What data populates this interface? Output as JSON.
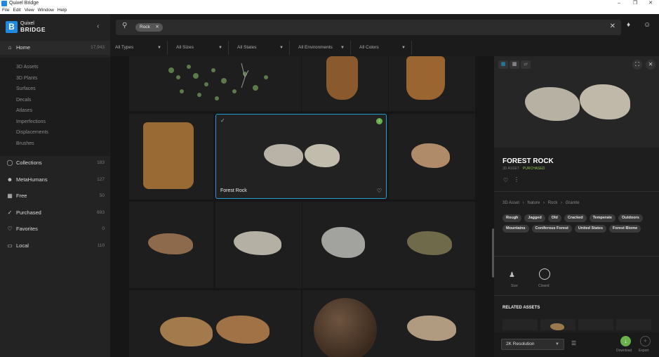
{
  "app": {
    "title": "Quixel Bridge",
    "menu": [
      "File",
      "Edit",
      "View",
      "Window",
      "Help"
    ]
  },
  "logo": {
    "line1": "Quixel",
    "line2": "BRIDGE"
  },
  "sidebar": {
    "home": {
      "label": "Home",
      "count": "17,943"
    },
    "sub_items": [
      "3D Assets",
      "3D Plants",
      "Surfaces",
      "Decals",
      "Atlases",
      "Imperfections",
      "Displacements",
      "Brushes"
    ],
    "items": [
      {
        "label": "Collections",
        "count": "183"
      },
      {
        "label": "MetaHumans",
        "count": "127"
      },
      {
        "label": "Free",
        "count": "50"
      },
      {
        "label": "Purchased",
        "count": "693"
      },
      {
        "label": "Favorites",
        "count": "0"
      },
      {
        "label": "Local",
        "count": "110"
      }
    ]
  },
  "search": {
    "chip": "Rock"
  },
  "filters": [
    "All Types",
    "All Sizes",
    "All States",
    "All Environments",
    "All Colors"
  ],
  "grid": {
    "selected_label": "Forest Rock"
  },
  "panel": {
    "title": "FOREST ROCK",
    "type": "3D ASSET",
    "status": "PURCHASED",
    "breadcrumb": [
      "3D Asset",
      "Nature",
      "Rock",
      "Granite"
    ],
    "tags": [
      "Rough",
      "Jagged",
      "Old",
      "Cracked",
      "Temperate",
      "Outdoors",
      "Mountains",
      "Coniferous Forest",
      "United States",
      "Forest Biome"
    ],
    "size_label": "Size",
    "shape_label": "Closed",
    "related": "RELATED ASSETS",
    "resolution": "2K Resolution",
    "download": "Download",
    "export": "Export"
  },
  "colors": {
    "accent": "#1f9bd8",
    "download": "#6ab04c",
    "purchased": "#8bc34a"
  }
}
